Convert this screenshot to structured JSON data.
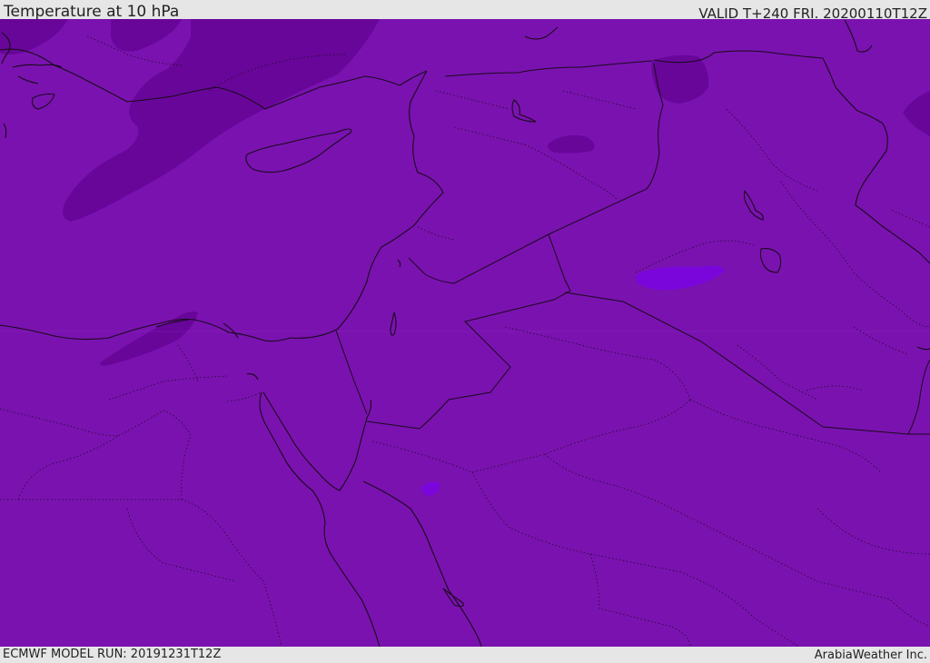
{
  "header": {
    "title": "Temperature at 10 hPa",
    "valid": "VALID T+240 FRI. 20200110T12Z"
  },
  "footer": {
    "model_run": "ECMWF MODEL RUN: 20191231T12Z",
    "credit": "ArabiaWeather Inc."
  },
  "colors": {
    "base_fill": "#7a12b0",
    "cooler_band": "#68069a",
    "warmer_patch": "#7a06dc",
    "coastline": "#1a0a1a",
    "bar_background": "#e6e6e6"
  }
}
